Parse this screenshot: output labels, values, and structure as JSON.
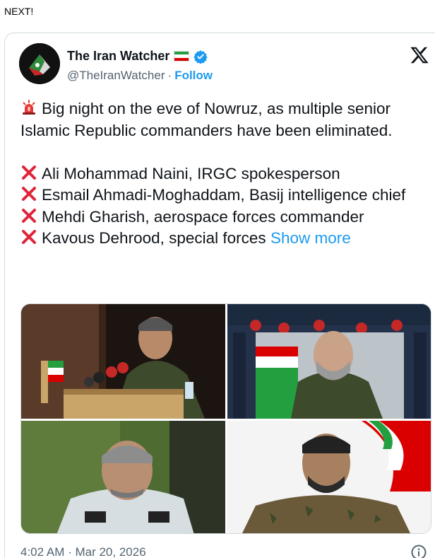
{
  "page": {
    "label": "NEXT!"
  },
  "author": {
    "name": "The Iran Watcher",
    "handle": "@TheIranWatcher",
    "separator": "·",
    "follow_label": "Follow",
    "flag_colors": [
      "#239f40",
      "#ffffff",
      "#da0000"
    ],
    "verified_color": "#1d9bf0"
  },
  "tweet": {
    "intro": "Big night on the eve of Nowruz, as multiple senior Islamic Republic commanders have been eliminated.",
    "items": [
      "Ali Mohammad Naini, IRGC spokesperson",
      "Esmail Ahmadi-Moghaddam, Basij intelligence chief",
      "Mehdi Gharish, aerospace forces commander",
      "Kavous Dehrood, special forces"
    ],
    "show_more": "Show more",
    "intro_icon": "police-light-emoji",
    "item_icon": "cross-mark-emoji"
  },
  "media": {
    "images": [
      {
        "name": "photo-commander-at-podium"
      },
      {
        "name": "photo-memorial-banner"
      },
      {
        "name": "photo-commander-uniform"
      },
      {
        "name": "photo-soldier-with-flag"
      }
    ]
  },
  "footer": {
    "timestamp": "4:02 AM · Mar 20, 2026",
    "info_icon": "info-icon"
  },
  "colors": {
    "accent": "#1d9bf0",
    "text": "#0f1419",
    "muted": "#536471",
    "border": "#cfd9de",
    "cross": "#e0243a"
  }
}
